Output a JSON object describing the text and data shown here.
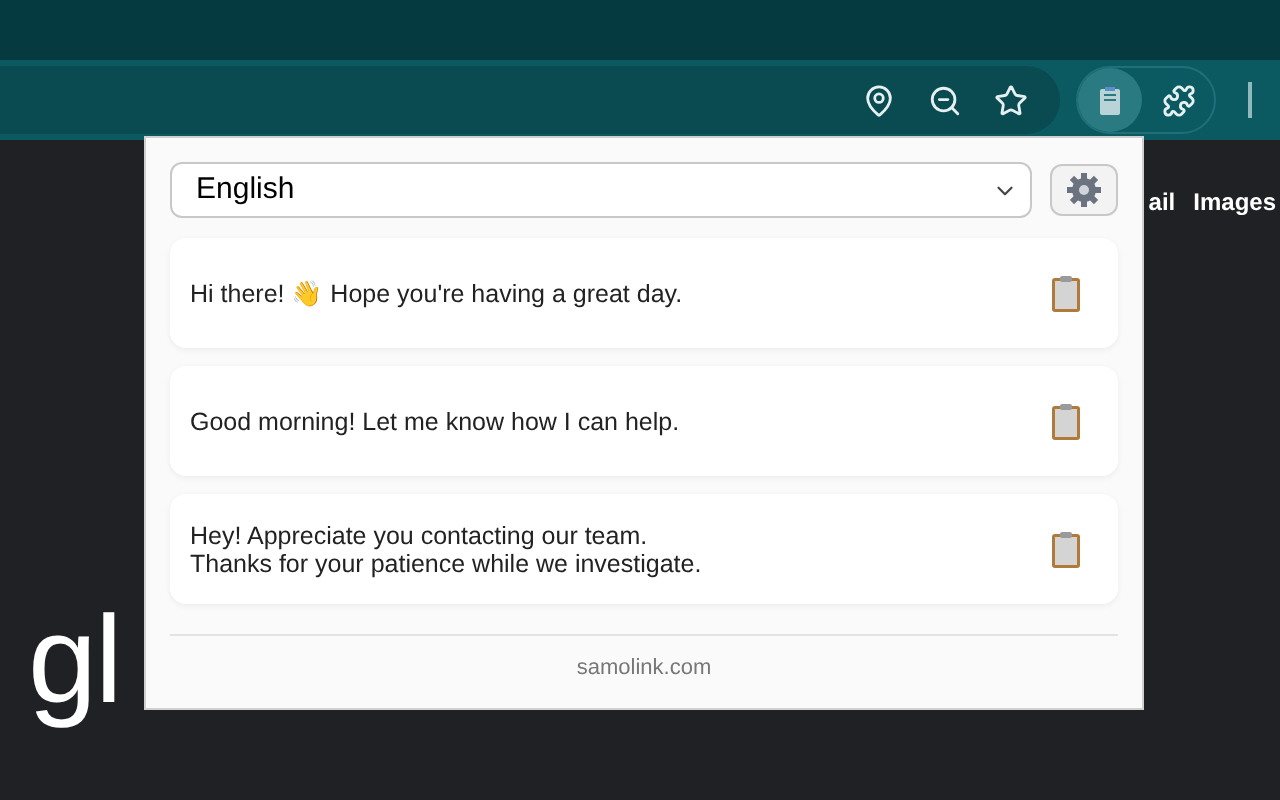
{
  "page": {
    "links": [
      "ail",
      "Images"
    ],
    "logo_fragment": "gl"
  },
  "popup": {
    "language_select": {
      "value": "English"
    },
    "messages": [
      {
        "text": "Hi there! 👋 Hope you're having a great day."
      },
      {
        "text": "Good morning! Let me know how I can help."
      },
      {
        "text": "Hey! Appreciate you contacting our team.\nThanks for your patience while we investigate."
      }
    ],
    "footer": "samolink.com"
  }
}
